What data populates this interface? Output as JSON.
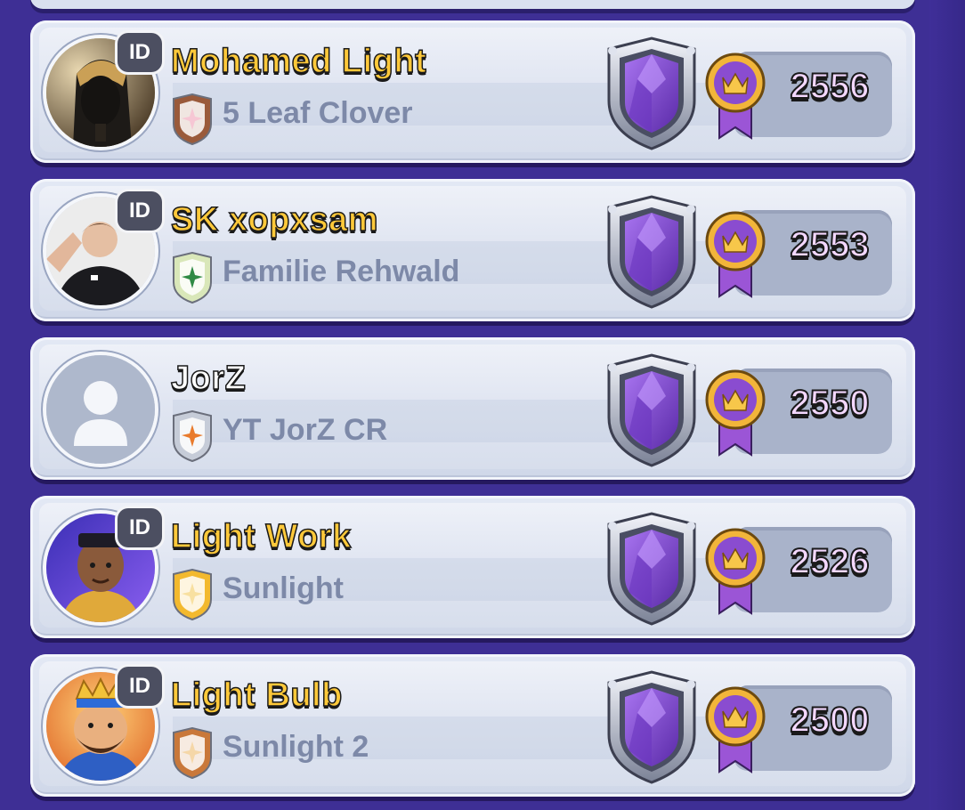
{
  "leaderboard": {
    "id_badge_label": "ID",
    "rows": [
      {
        "name": "Mohamed Light",
        "name_color": "gold",
        "clan": "5 Leaf Clover",
        "score": "2556",
        "has_id": true,
        "clan_badge_color": "#9a5a3a",
        "clan_badge_inner": "#f6c7d4",
        "avatar": "pharaoh"
      },
      {
        "name": "SK xopxsam",
        "name_color": "gold",
        "clan": "Familie Rehwald",
        "score": "2553",
        "has_id": true,
        "clan_badge_color": "#d9e7b9",
        "clan_badge_inner": "#2f8a45",
        "avatar": "player"
      },
      {
        "name": "JorZ",
        "name_color": "white",
        "clan": "YT JorZ CR",
        "score": "2550",
        "has_id": false,
        "clan_badge_color": "#c6ccd8",
        "clan_badge_inner": "#e97b2c",
        "avatar": "default"
      },
      {
        "name": "Light Work",
        "name_color": "gold",
        "clan": "Sunlight",
        "score": "2526",
        "has_id": true,
        "clan_badge_color": "#f3b92e",
        "clan_badge_inner": "#f8e0a0",
        "avatar": "character"
      },
      {
        "name": "Light Bulb",
        "name_color": "gold",
        "clan": "Sunlight 2",
        "score": "2500",
        "has_id": true,
        "clan_badge_color": "#c9783a",
        "clan_badge_inner": "#f5d7a8",
        "avatar": "king"
      }
    ]
  },
  "colors": {
    "background": "#3e2f95",
    "row_bg": "#dbe2f0",
    "score_box": "#a9b3ca",
    "score_text": "#f4d8ff",
    "name_gold": "#ffc93a",
    "arena_purple": "#7b46c9",
    "medal_gold": "#f2b53a",
    "ribbon_purple": "#9b55d6"
  },
  "icons": {
    "arena": "arena-shield-icon",
    "medal": "crown-medal-icon",
    "id": "id-badge-icon"
  }
}
